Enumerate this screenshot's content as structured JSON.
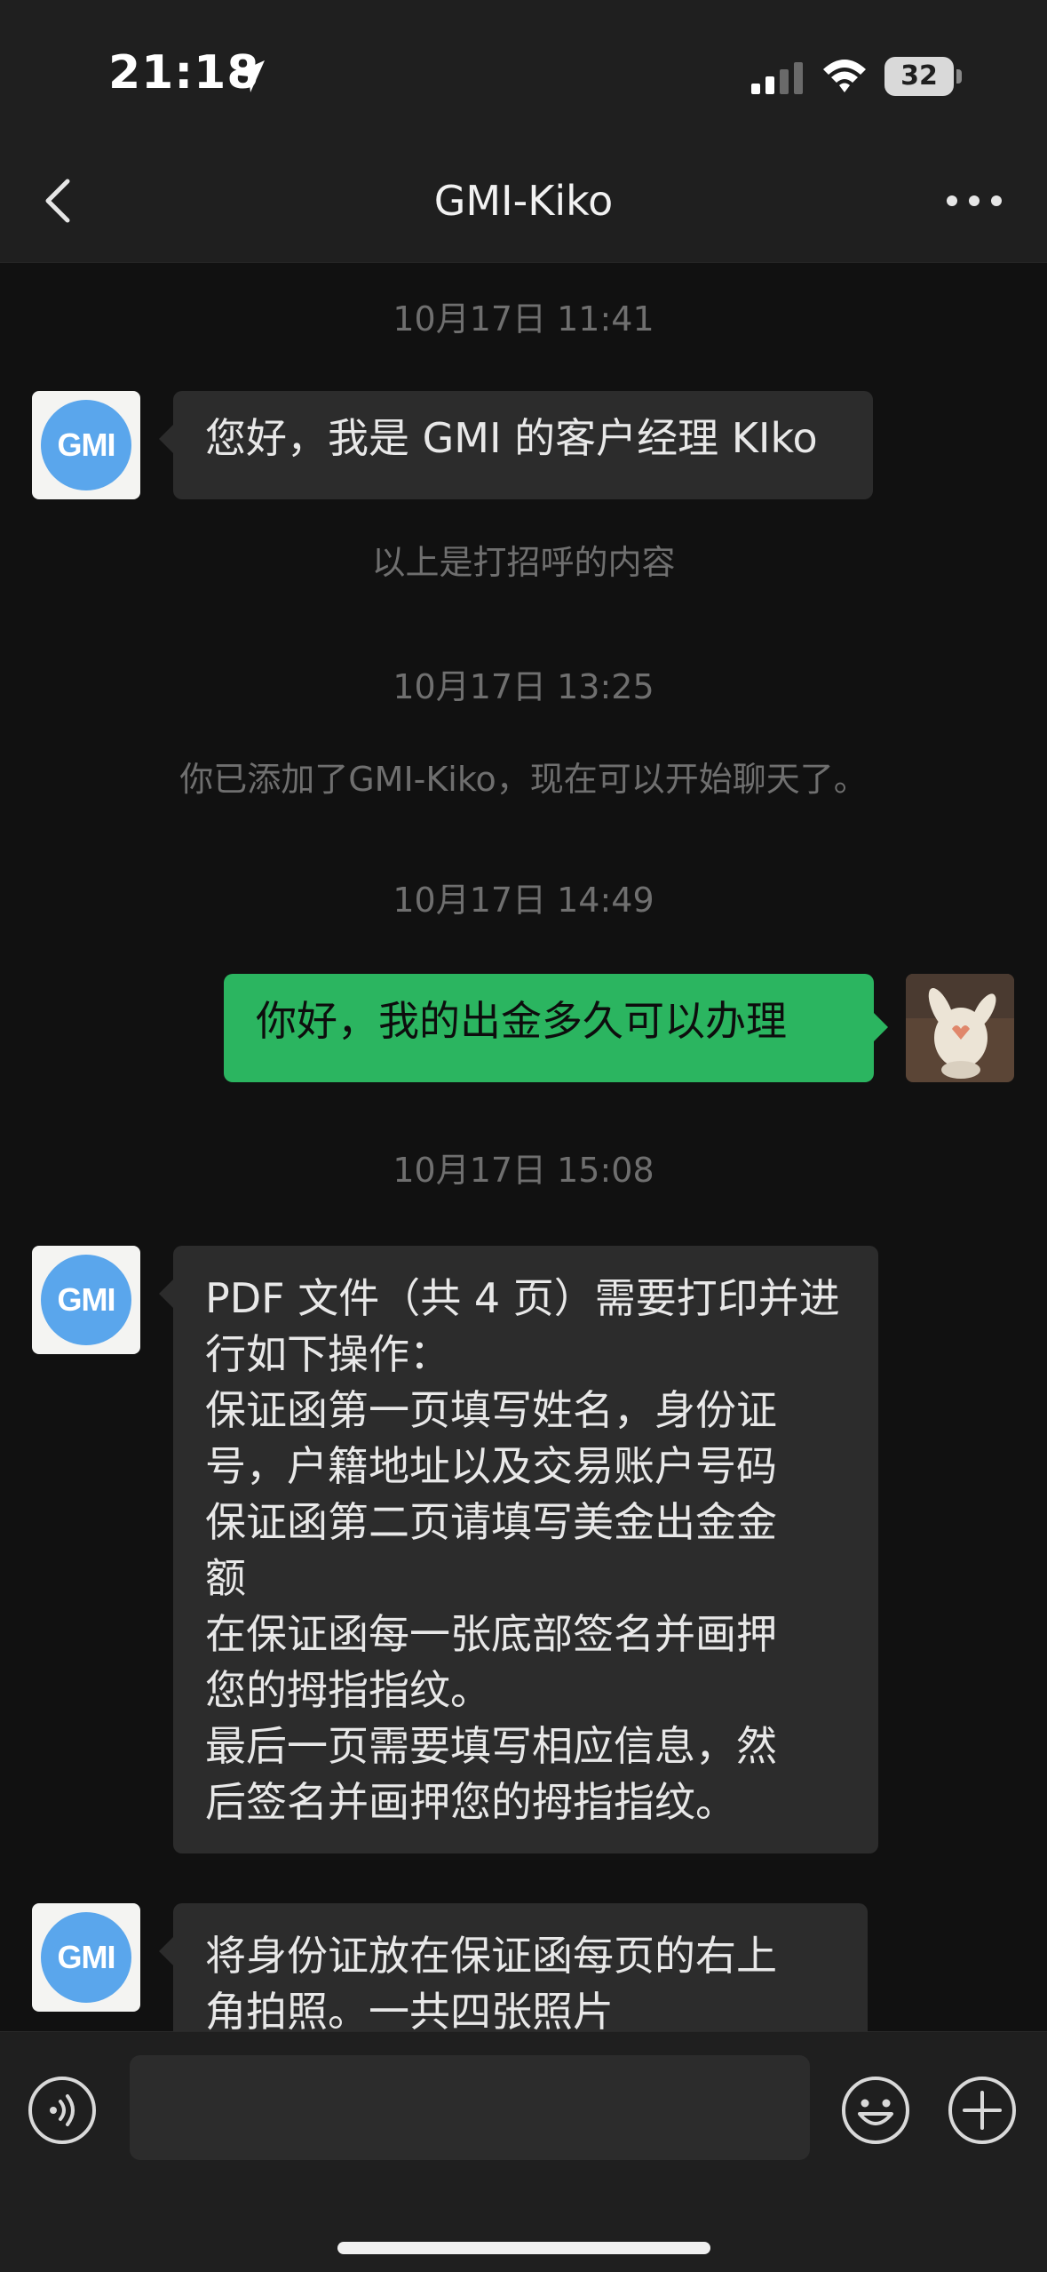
{
  "status_bar": {
    "time": "21:18",
    "battery": "32",
    "icons": [
      "location-arrow-icon",
      "cellular-signal-icon",
      "wifi-icon",
      "battery-icon"
    ]
  },
  "nav": {
    "title": "GMI-Kiko",
    "back_icon": "chevron-left-icon",
    "more_icon": "more-dots-icon"
  },
  "contact": {
    "avatar_logo": "GMI"
  },
  "chat": {
    "timestamps": [
      "10月17日 11:41",
      "10月17日 13:25",
      "10月17日 14:49",
      "10月17日 15:08"
    ],
    "system_notes": [
      "以上是打招呼的内容",
      "你已添加了GMI-Kiko，现在可以开始聊天了。"
    ],
    "messages": [
      {
        "sender": "GMI-Kiko",
        "lines": [
          "您好，我是 GMI 的客户经理 KIko"
        ]
      },
      {
        "sender": "me",
        "lines": [
          "你好，我的出金多久可以办理"
        ]
      },
      {
        "sender": "GMI-Kiko",
        "lines": [
          "PDF 文件（共 4 页）需要打印并进",
          "行如下操作：",
          "保证函第一页填写姓名，身份证",
          "号，户籍地址以及交易账户号码",
          "保证函第二页请填写美金出金金",
          "额",
          "在保证函每一张底部签名并画押",
          "您的拇指指纹。",
          "最后一页需要填写相应信息，然",
          "后签名并画押您的拇指指纹。"
        ]
      },
      {
        "sender": "GMI-Kiko",
        "lines": [
          "将身份证放在保证函每页的右上",
          "角拍照。一共四张照片"
        ]
      }
    ]
  },
  "input_bar": {
    "voice_icon": "voice-input-icon",
    "message_value": "",
    "emoji_icon": "emoji-icon",
    "plus_icon": "plus-circle-icon"
  },
  "colors": {
    "background": "#111111",
    "bar": "#1f1f1f",
    "incoming_bubble": "#2c2c2c",
    "outgoing_bubble": "#2bb560",
    "avatar_blue": "#5aa6ec"
  }
}
